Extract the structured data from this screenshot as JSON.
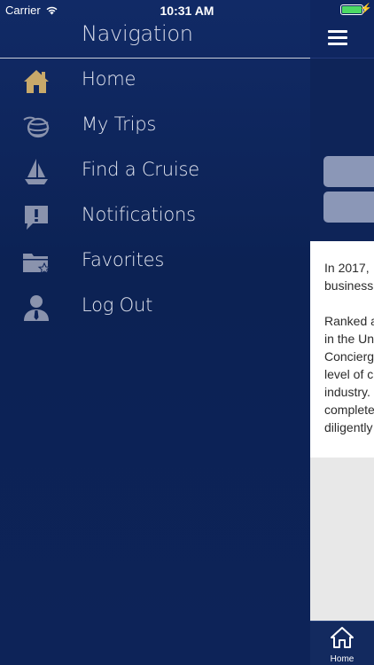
{
  "status_bar": {
    "carrier": "Carrier",
    "time": "10:31 AM"
  },
  "drawer": {
    "title": "Navigation",
    "items": [
      {
        "label": "Home",
        "icon": "home-icon"
      },
      {
        "label": "My Trips",
        "icon": "globe-icon"
      },
      {
        "label": "Find a Cruise",
        "icon": "sailboat-icon"
      },
      {
        "label": "Notifications",
        "icon": "notification-icon"
      },
      {
        "label": "Favorites",
        "icon": "folder-star-icon"
      },
      {
        "label": "Log Out",
        "icon": "user-icon"
      }
    ],
    "icon_color": "#c8a96a",
    "muted_icon_color": "#8a93ad"
  },
  "content": {
    "paragraph_1": [
      "In 2017,",
      "business"
    ],
    "paragraph_2": [
      "Ranked a",
      "in the Un",
      "Concierg",
      "level of c",
      "industry.",
      "complete",
      "diligently"
    ],
    "tab_bar": {
      "home_label": "Home"
    }
  },
  "colors": {
    "drawer_bg": "#0e2458",
    "label_text": "#e3e6f0",
    "button_pill": "#8b97b7"
  }
}
